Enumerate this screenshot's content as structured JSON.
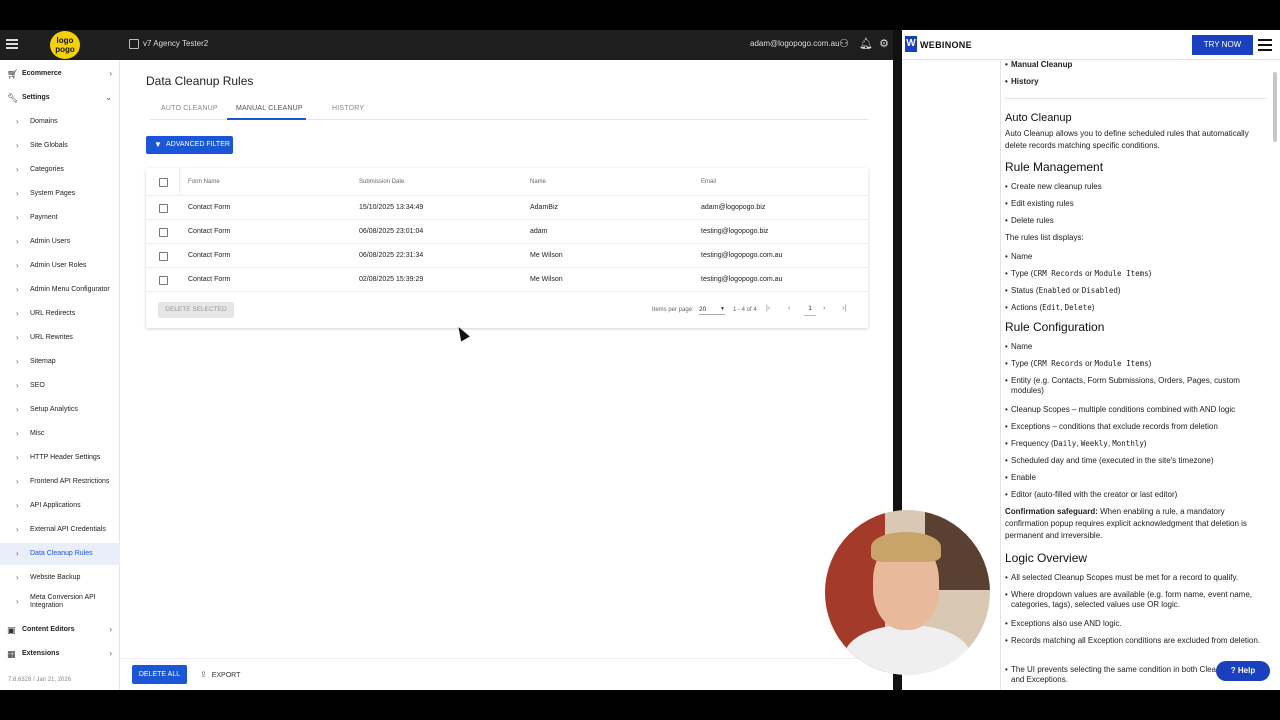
{
  "app": {
    "site_name": "v7 Agency Tester2",
    "user_email": "adam@logopogo.com.au",
    "logo_text": "logo pogo",
    "version": "7.8.6328 / Jan 21, 2026"
  },
  "sidebar": {
    "sections": [
      {
        "label": "Ecommerce",
        "icon": "cart-icon"
      },
      {
        "label": "Settings",
        "icon": "wrench-icon"
      }
    ],
    "items": [
      {
        "label": "Domains"
      },
      {
        "label": "Site Globals"
      },
      {
        "label": "Categories"
      },
      {
        "label": "System Pages"
      },
      {
        "label": "Payment"
      },
      {
        "label": "Admin Users"
      },
      {
        "label": "Admin User Roles"
      },
      {
        "label": "Admin Menu Configurator"
      },
      {
        "label": "URL Redirects"
      },
      {
        "label": "URL Rewrites"
      },
      {
        "label": "Sitemap"
      },
      {
        "label": "SEO"
      },
      {
        "label": "Setup Analytics"
      },
      {
        "label": "Misc"
      },
      {
        "label": "HTTP Header Settings"
      },
      {
        "label": "Frontend API Restrictions"
      },
      {
        "label": "API Applications"
      },
      {
        "label": "External API Credentials"
      },
      {
        "label": "Data Cleanup Rules"
      },
      {
        "label": "Website Backup"
      },
      {
        "label": "Meta Conversion API Integration"
      }
    ],
    "bottom_sections": [
      {
        "label": "Content Editors",
        "icon": "edit-icon"
      },
      {
        "label": "Extensions",
        "icon": "grid-icon"
      }
    ]
  },
  "main": {
    "title": "Data Cleanup Rules",
    "tabs": [
      {
        "label": "AUTO CLEANUP"
      },
      {
        "label": "MANUAL CLEANUP"
      },
      {
        "label": "HISTORY"
      }
    ],
    "filter_label": "ADVANCED FILTER",
    "table": {
      "columns": [
        "Form Name",
        "Submission Date",
        "Name",
        "Email"
      ],
      "rows": [
        {
          "form": "Contact Form",
          "date": "15/10/2025 13:34:49",
          "name": "AdamBiz",
          "email": "adam@logopogo.biz"
        },
        {
          "form": "Contact Form",
          "date": "06/08/2025 23:01:04",
          "name": "adam",
          "email": "testing@logopogo.biz"
        },
        {
          "form": "Contact Form",
          "date": "06/08/2025 22:31:34",
          "name": "Me Wilson",
          "email": "testing@logopogo.com.au"
        },
        {
          "form": "Contact Form",
          "date": "02/08/2025 15:39:29",
          "name": "Me Wilson",
          "email": "testing@logopogo.com.au"
        }
      ]
    },
    "delete_selected": "DELETE SELECTED",
    "pagination": {
      "items_per_page_label": "Items per page:",
      "items_per_page": "20",
      "range": "1 - 4 of 4",
      "page": "1"
    },
    "delete_all": "DELETE ALL",
    "export": "EXPORT"
  },
  "docs": {
    "brand": "WEBINONE",
    "try_now": "TRY NOW",
    "toc": [
      "Manual Cleanup",
      "History"
    ],
    "auto_cleanup_heading": "Auto Cleanup",
    "auto_cleanup_text": "Auto Cleanup allows you to define scheduled rules that automatically delete records matching specific conditions.",
    "rule_mgmt_heading": "Rule Management",
    "rule_mgmt_items": [
      "Create new cleanup rules",
      "Edit existing rules",
      "Delete rules"
    ],
    "rules_list_intro": "The rules list displays:",
    "rules_list": {
      "name": "Name",
      "type_pre": "Type (",
      "type_a": "CRM Records",
      "or1": " or ",
      "type_b": "Module Items",
      "type_post": ")",
      "status_pre": "Status (",
      "status_a": "Enabled",
      "or2": " or ",
      "status_b": "Disabled",
      "status_post": ")",
      "actions_pre": "Actions (",
      "actions_a": "Edit",
      "comma": ", ",
      "actions_b": "Delete",
      "actions_post": ")"
    },
    "rule_config_heading": "Rule Configuration",
    "rule_config": {
      "name": "Name",
      "type_pre": "Type (",
      "type_a": "CRM Records",
      "or1": " or ",
      "type_b": "Module Items",
      "type_post": ")",
      "entity": "Entity (e.g. Contacts, Form Submissions, Orders, Pages, custom modules)",
      "scopes": "Cleanup Scopes – multiple conditions combined with AND logic",
      "exceptions": "Exceptions – conditions that exclude records from deletion",
      "freq_pre": "Frequency (",
      "freq_a": "Daily",
      "freq_b": "Weekly",
      "freq_c": "Monthly",
      "freq_sep": ", ",
      "freq_post": ")",
      "schedule": "Scheduled day and time (executed in the site's timezone)",
      "enable": "Enable",
      "editor": "Editor (auto-filled with the creator or last editor)"
    },
    "safeguard_label": "Confirmation safeguard:",
    "safeguard_text": " When enabling a rule, a mandatory confirmation popup requires explicit acknowledgment that deletion is permanent and irreversible.",
    "logic_heading": "Logic Overview",
    "logic_items": [
      "All selected Cleanup Scopes must be met for a record to qualify.",
      "Where dropdown values are available (e.g. form name, event name, categories, tags), selected values use OR logic.",
      "Exceptions also use AND logic.",
      "Records matching all Exception conditions are excluded from deletion.",
      "The UI prevents selecting the same condition in both Cleanup Scopes and Exceptions."
    ],
    "help_label": "Help"
  },
  "colors": {
    "accent": "#1a56d6",
    "brand": "#1a3fbf",
    "topbar": "#1e1e1e",
    "logo": "#f2d200"
  }
}
